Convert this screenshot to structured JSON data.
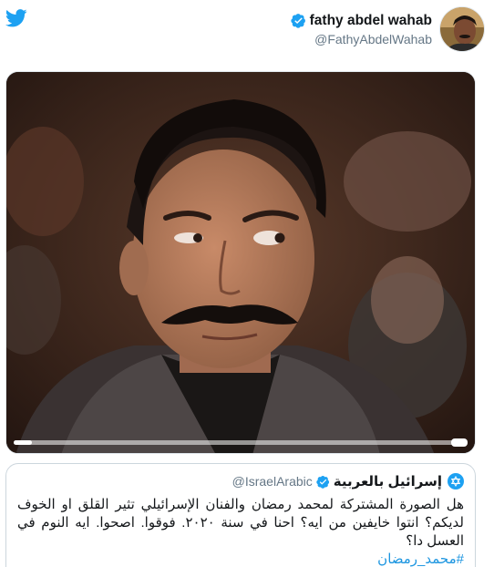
{
  "brand": {
    "logo_icon": "twitter-bird-icon",
    "color": "#1da1f2"
  },
  "author": {
    "display_name": "fathy abdel wahab",
    "handle": "@FathyAbdelWahab",
    "verified": true,
    "avatar_icon": "profile-photo"
  },
  "media": {
    "type": "video",
    "progress_fraction": 0.04
  },
  "quoted_tweet": {
    "display_name": "إسرائيل بالعربية",
    "handle": "@IsraelArabic",
    "verified": true,
    "text": "هل الصورة المشتركة لمحمد رمضان والفنان الإسرائيلي تثير القلق او الخوف لديكم؟ انتوا خايفين من ايه؟ احنا في سنة ٢٠٢٠. فوقوا. اصحوا. ايه النوم في العسل دا؟",
    "hashtag": "#محمد_رمضان"
  },
  "colors": {
    "text_primary": "#14171a",
    "text_secondary": "#657786",
    "link": "#1b95e0",
    "border": "#ccd6dd"
  }
}
